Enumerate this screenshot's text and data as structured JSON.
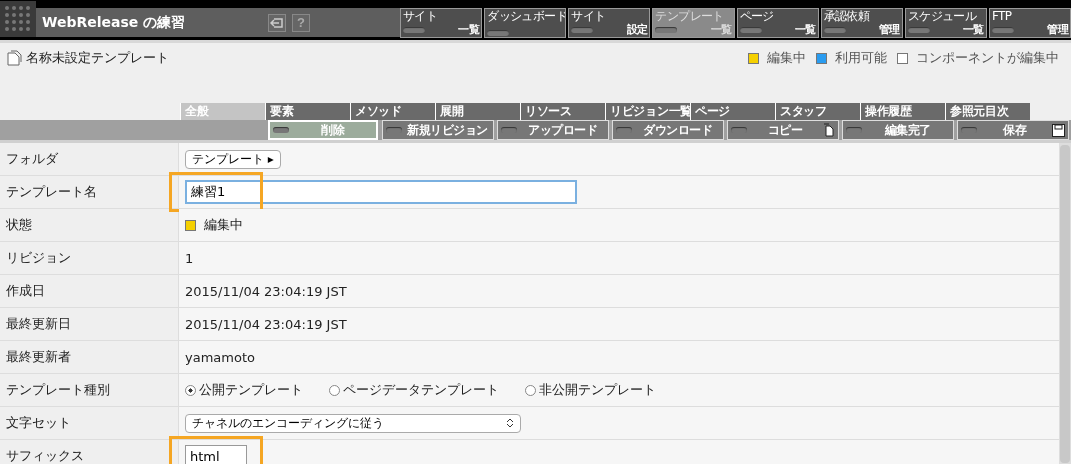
{
  "header": {
    "title": "WebRelease の練習",
    "help_label": "?"
  },
  "nav": [
    {
      "top": "サイト",
      "bottom": "一覧",
      "selected": false
    },
    {
      "top": "ダッシュボード",
      "selected": false
    },
    {
      "top": "サイト",
      "bottom": "設定",
      "selected": false
    },
    {
      "top": "テンプレート",
      "bottom": "一覧",
      "selected": true
    },
    {
      "top": "ページ",
      "bottom": "一覧",
      "selected": false
    },
    {
      "top": "承認依頼",
      "bottom": "管理",
      "selected": false
    },
    {
      "top": "スケジュール",
      "bottom": "一覧",
      "selected": false
    },
    {
      "top": "FTP",
      "bottom": "管理",
      "selected": false
    }
  ],
  "page_title": "名称未設定テンプレート",
  "legend": [
    {
      "label": "編集中",
      "color": "#f5d000"
    },
    {
      "label": "利用可能",
      "color": "#2a9cf0"
    },
    {
      "label": "コンポーネントが編集中",
      "color": "#ffffff"
    }
  ],
  "tabs": [
    {
      "label": "全般",
      "selected": true
    },
    {
      "label": "要素",
      "selected": false
    },
    {
      "label": "メソッド",
      "selected": false
    },
    {
      "label": "展開",
      "selected": false
    },
    {
      "label": "リソース",
      "selected": false
    },
    {
      "label": "リビジョン一覧",
      "selected": false
    },
    {
      "label": "ページ",
      "selected": false
    },
    {
      "label": "スタッフ",
      "selected": false
    },
    {
      "label": "操作履歴",
      "selected": false
    },
    {
      "label": "参照元目次",
      "selected": false
    }
  ],
  "toolbar": [
    {
      "label": "削除",
      "kind": "plain",
      "active": true
    },
    {
      "label": "新規リビジョン",
      "kind": "plain",
      "active": false
    },
    {
      "label": "アップロード",
      "kind": "plain",
      "active": false
    },
    {
      "label": "ダウンロード",
      "kind": "plain",
      "active": false
    },
    {
      "label": "コピー",
      "kind": "copy",
      "active": false
    },
    {
      "label": "編集完了",
      "kind": "plain",
      "active": false
    },
    {
      "label": "保存",
      "kind": "save",
      "active": false
    }
  ],
  "rows": [
    {
      "label": "フォルダ",
      "kind": "select",
      "value": "テンプレート ▸"
    },
    {
      "label": "テンプレート名",
      "kind": "input",
      "value": "練習1",
      "highlighted": true
    },
    {
      "label": "状態",
      "kind": "status",
      "value": "編集中",
      "color": "#f5d000"
    },
    {
      "label": "リビジョン",
      "kind": "text",
      "value": "1"
    },
    {
      "label": "作成日",
      "kind": "text",
      "value": "2015/11/04 23:04:19 JST"
    },
    {
      "label": "最終更新日",
      "kind": "text",
      "value": "2015/11/04 23:04:19 JST"
    },
    {
      "label": "最終更新者",
      "kind": "text",
      "value": "yamamoto"
    },
    {
      "label": "テンプレート種別",
      "kind": "radio",
      "options": [
        {
          "label": "公開テンプレート",
          "selected": true
        },
        {
          "label": "ページデータテンプレート",
          "selected": false
        },
        {
          "label": "非公開テンプレート",
          "selected": false
        }
      ]
    },
    {
      "label": "文字セット",
      "kind": "wideselect",
      "value": "チャネルのエンコーディングに従う"
    },
    {
      "label": "サフィックス",
      "kind": "smallinput",
      "value": "html",
      "highlighted": true
    }
  ]
}
